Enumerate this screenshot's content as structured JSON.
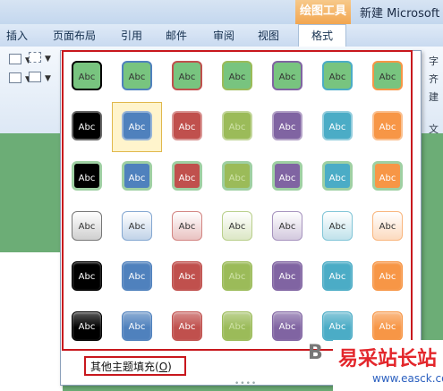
{
  "title_bar": {
    "context_tab": "绘图工具",
    "window_title": "新建 Microsoft W"
  },
  "tabs": [
    "插入",
    "页面布局",
    "引用",
    "邮件",
    "审阅",
    "视图",
    "格式"
  ],
  "active_tab": "格式",
  "ribbon_right": [
    "字",
    "齐",
    "建",
    "文本"
  ],
  "gallery": {
    "swatch_label": "Abc",
    "colors": [
      "#000000",
      "#4f81bd",
      "#c0504d",
      "#9bbb59",
      "#8064a2",
      "#4bacc6",
      "#f79646"
    ],
    "styles": [
      "colored-outline",
      "colored-fill",
      "light-fill",
      "light-gradient",
      "intense",
      "glossy"
    ],
    "selected": {
      "row": 1,
      "col": 1
    }
  },
  "more_fills": {
    "label": "其他主题填充(",
    "accel": "O",
    "suffix": ")"
  },
  "watermark": {
    "logo": "B",
    "text": "易采站长站",
    "url": "www.easck.com"
  }
}
